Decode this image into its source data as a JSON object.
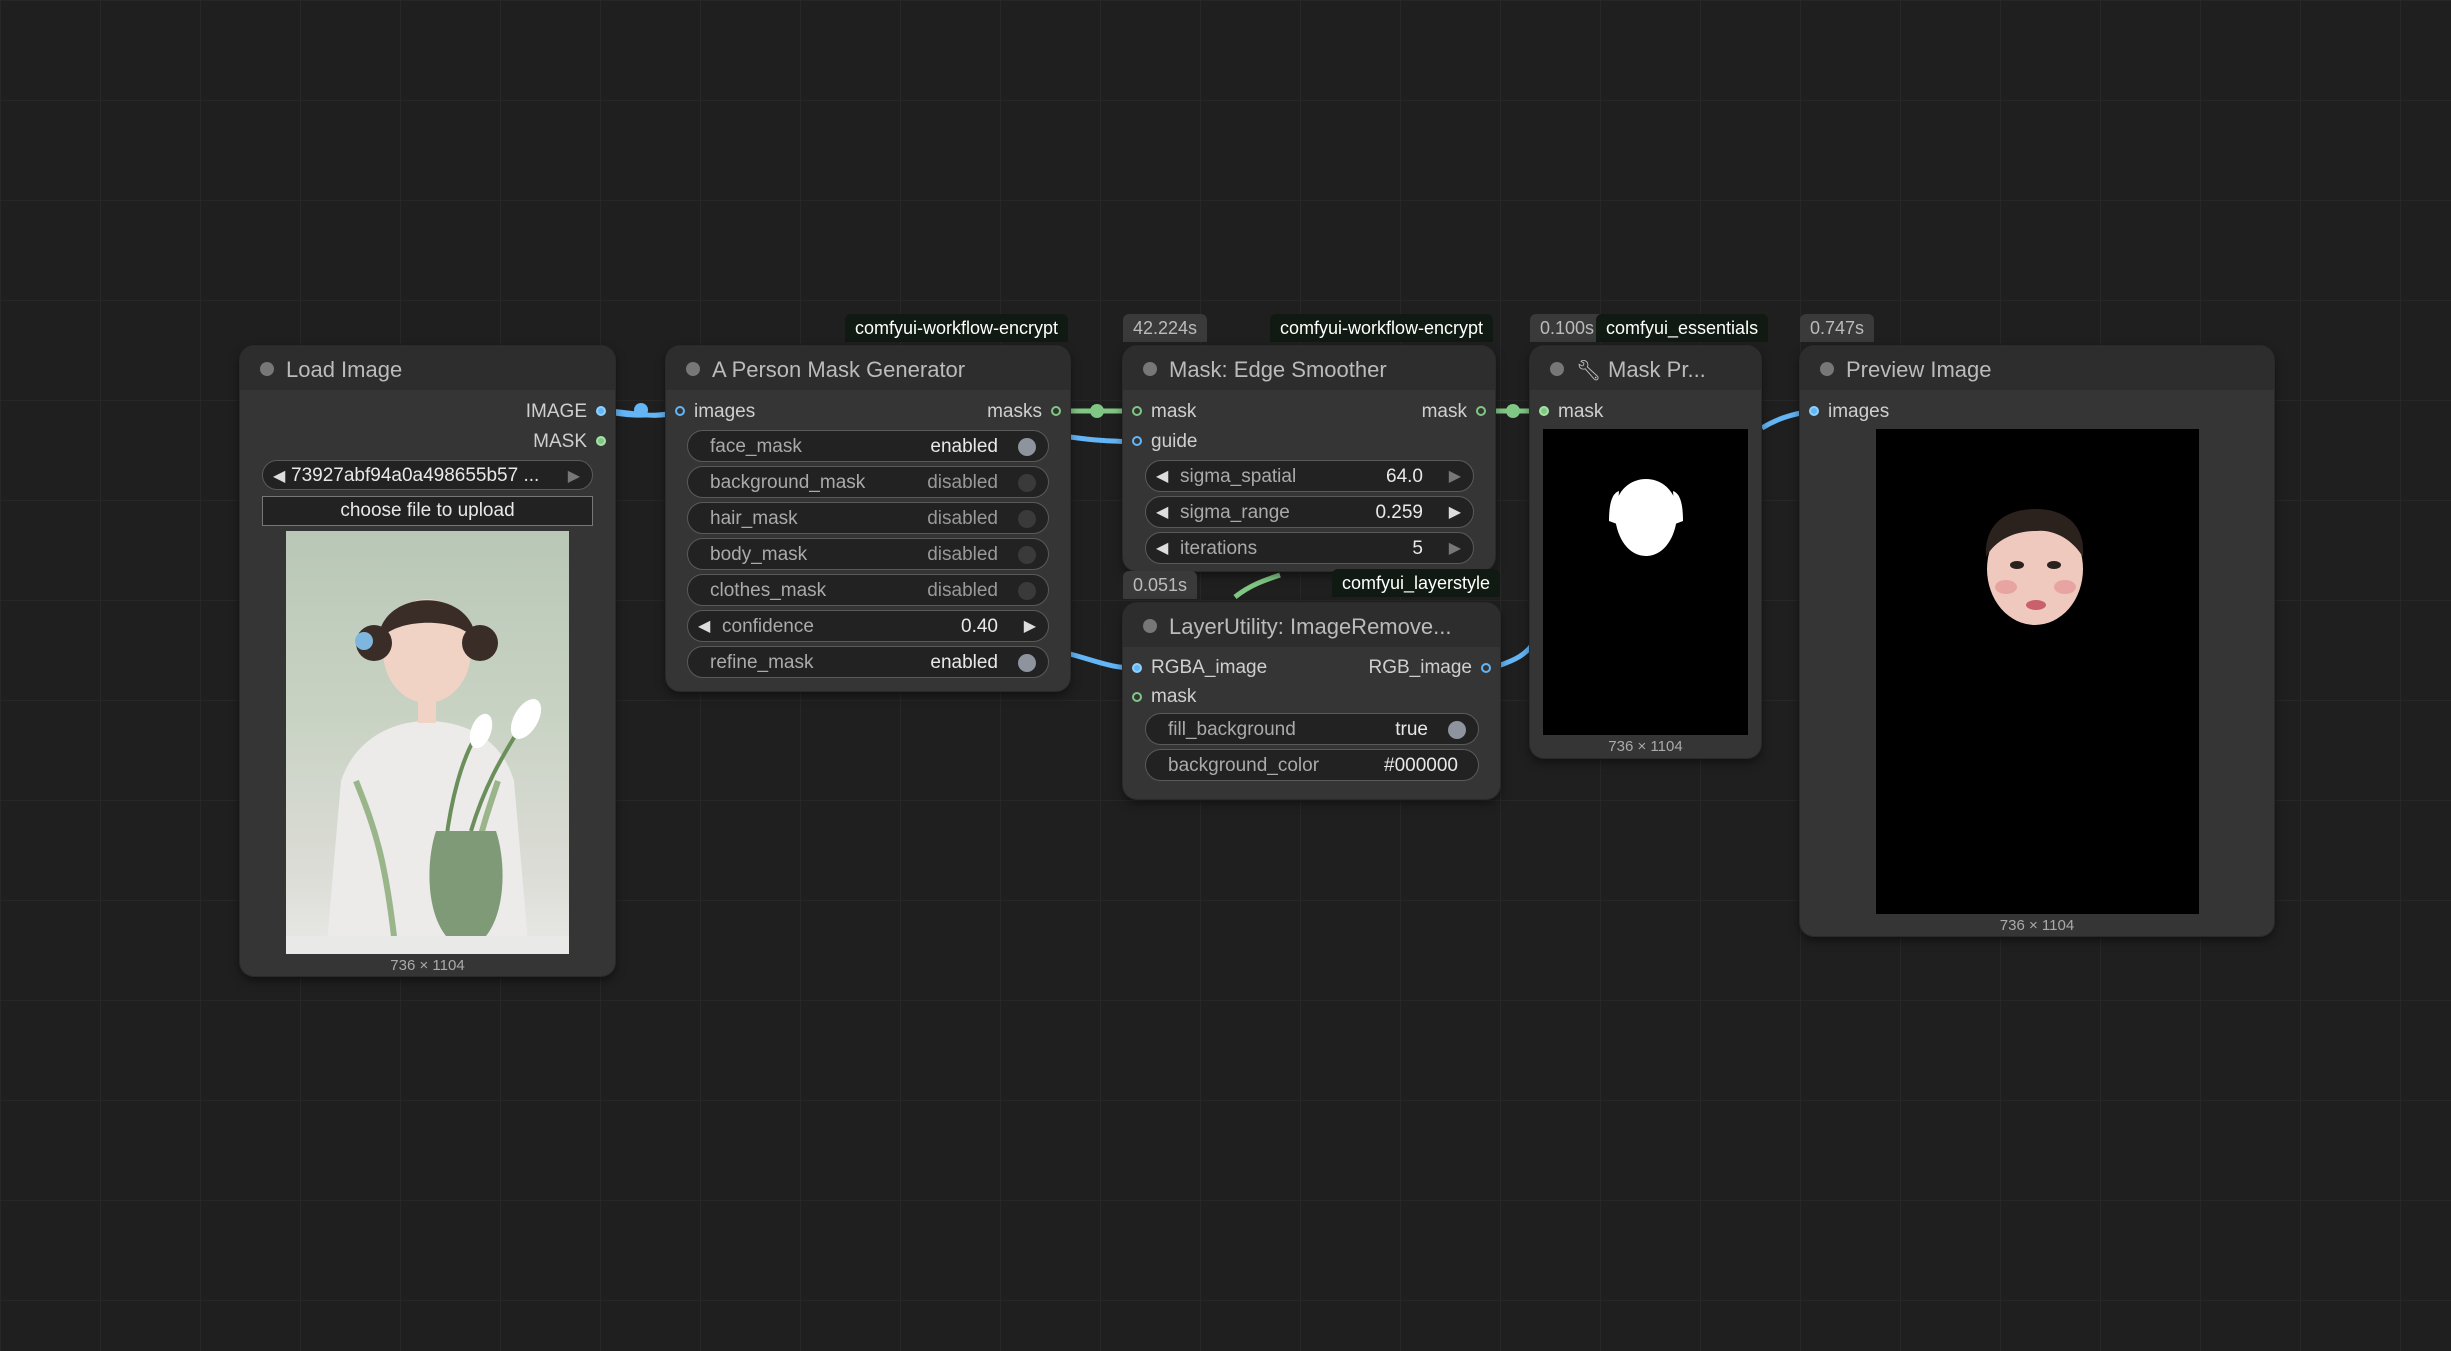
{
  "colors": {
    "canvas": "#1f1f1f",
    "node_body": "#353535",
    "node_title": "#2d2d2d",
    "image_link": "#64b5f6",
    "mask_link": "#81c784",
    "badge_bg": "#101a12"
  },
  "nodes": {
    "load_image": {
      "title": "Load Image",
      "outputs": [
        "IMAGE",
        "MASK"
      ],
      "filename": "73927abf94a0a498655b57 ...",
      "upload_label": "choose file to upload",
      "size": "736 × 1104"
    },
    "person_mask": {
      "badge": "comfyui-workflow-encrypt",
      "title": "A Person Mask Generator",
      "input": "images",
      "output": "masks",
      "widgets": [
        {
          "label": "face_mask",
          "value": "enabled"
        },
        {
          "label": "background_mask",
          "value": "disabled"
        },
        {
          "label": "hair_mask",
          "value": "disabled"
        },
        {
          "label": "body_mask",
          "value": "disabled"
        },
        {
          "label": "clothes_mask",
          "value": "disabled"
        },
        {
          "label": "confidence",
          "value": "0.40"
        },
        {
          "label": "refine_mask",
          "value": "enabled"
        }
      ]
    },
    "edge_smoother": {
      "timing": "42.224s",
      "badge": "comfyui-workflow-encrypt",
      "title": "Mask: Edge Smoother",
      "inputs": [
        "mask",
        "guide"
      ],
      "output": "mask",
      "widgets": [
        {
          "label": "sigma_spatial",
          "value": "64.0"
        },
        {
          "label": "sigma_range",
          "value": "0.259"
        },
        {
          "label": "iterations",
          "value": "5"
        }
      ]
    },
    "image_remove": {
      "timing": "0.051s",
      "badge": "comfyui_layerstyle",
      "title": "LayerUtility: ImageRemove...",
      "inputs": [
        "RGBA_image",
        "mask"
      ],
      "output": "RGB_image",
      "widgets": [
        {
          "label": "fill_background",
          "value": "true"
        },
        {
          "label": "background_color",
          "value": "#000000"
        }
      ]
    },
    "mask_preview": {
      "timing": "0.100s",
      "badge": "comfyui_essentials",
      "title": "Mask Pr...",
      "icon": "wrench-icon",
      "input": "mask",
      "size": "736 × 1104"
    },
    "preview_image": {
      "timing": "0.747s",
      "title": "Preview Image",
      "input": "images",
      "size": "736 × 1104"
    }
  }
}
